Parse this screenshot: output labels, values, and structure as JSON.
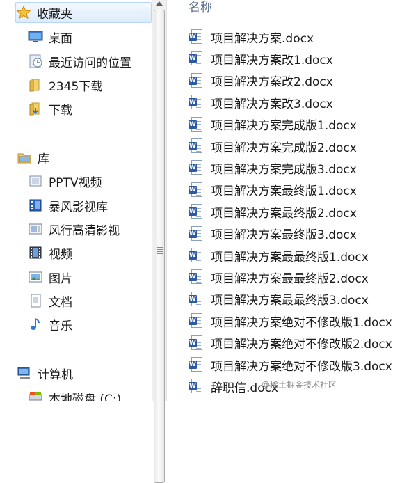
{
  "nav": {
    "favorites": {
      "label": "收藏夹",
      "icon": "star-icon"
    },
    "favorite_items": [
      {
        "label": "桌面",
        "icon": "desktop-icon"
      },
      {
        "label": "最近访问的位置",
        "icon": "recent-places-icon"
      },
      {
        "label": "2345下载",
        "icon": "folder-icon"
      },
      {
        "label": "下载",
        "icon": "downloads-folder-icon"
      }
    ],
    "libraries": {
      "label": "库",
      "icon": "library-icon"
    },
    "library_items": [
      {
        "label": "PPTV视频",
        "icon": "video-library-icon"
      },
      {
        "label": "暴风影视库",
        "icon": "film-library-icon"
      },
      {
        "label": "风行高清影视",
        "icon": "hd-video-icon"
      },
      {
        "label": "视频",
        "icon": "video-icon"
      },
      {
        "label": "图片",
        "icon": "pictures-icon"
      },
      {
        "label": "文档",
        "icon": "documents-icon"
      },
      {
        "label": "音乐",
        "icon": "music-icon"
      }
    ],
    "computer": {
      "label": "计算机",
      "icon": "computer-icon"
    },
    "drive": {
      "label": "本地磁盘 (C:)",
      "icon": "drive-icon"
    }
  },
  "list": {
    "column_header": "名称",
    "files": [
      "项目解决方案.docx",
      "项目解决方案改1.docx",
      "项目解决方案改2.docx",
      "项目解决方案改3.docx",
      "项目解决方案完成版1.docx",
      "项目解决方案完成版2.docx",
      "项目解决方案完成版3.docx",
      "项目解决方案最终版1.docx",
      "项目解决方案最终版2.docx",
      "项目解决方案最终版3.docx",
      "项目解决方案最最终版1.docx",
      "项目解决方案最最终版2.docx",
      "项目解决方案最最终版3.docx",
      "项目解决方案绝对不修改版1.docx",
      "项目解决方案绝对不修改版2.docx",
      "项目解决方案绝对不修改版3.docx",
      "辞职信.docx"
    ]
  },
  "watermark": "@稀土掘金技术社区",
  "colors": {
    "selection": "#dcebfc",
    "word_blue": "#2b5aa7",
    "header_text": "#5b6e8c"
  }
}
